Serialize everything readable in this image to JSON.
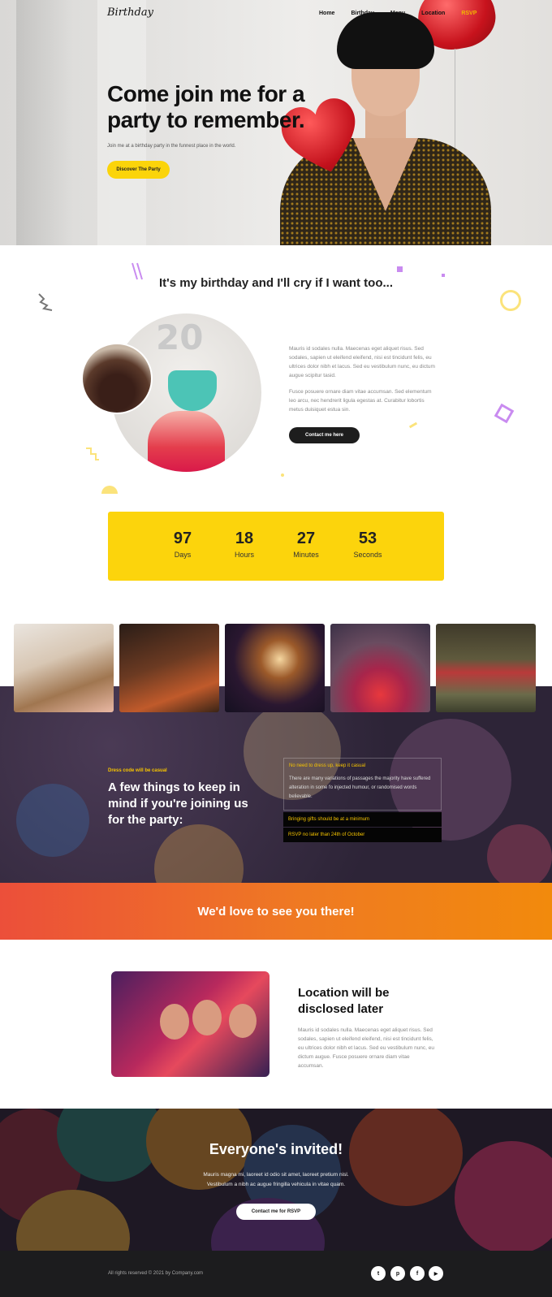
{
  "header": {
    "logo": "Birthday",
    "nav": [
      "Home",
      "Birthday",
      "Menu",
      "Location",
      "RSVP"
    ]
  },
  "hero": {
    "title": "Come join me for a party to remember.",
    "subtitle": "Join me at a birthday party in the funnest place in the world.",
    "cta": "Discover The Party"
  },
  "intro": {
    "title": "It's my birthday and I'll cry if I want too...",
    "balloon_text": "20",
    "p1": "Mauris id sodales nulla. Maecenas eget aliquet risus. Sed sodales, sapien ut eleifend eleifend, nisi est tincidunt felis, eu ultrices dolor nibh et lacus. Sed eu vestibulum nunc, eu dictum augue scipitur tasid.",
    "p2": "Fusce posuere ornare diam vitae accumsan. Sed elementum leo arcu, nec hendrerit ligula egestas at. Curabitur lobortis metus duisiquet estua sin.",
    "cta": "Contact me here"
  },
  "countdown": [
    {
      "value": "97",
      "label": "Days"
    },
    {
      "value": "18",
      "label": "Hours"
    },
    {
      "value": "27",
      "label": "Minutes"
    },
    {
      "value": "53",
      "label": "Seconds"
    }
  ],
  "things": {
    "eyebrow": "Dress code will be casual",
    "title": "A few things to keep in mind if you're joining us for the party:",
    "open_title": "No need to dress up, keep it casual",
    "open_body": "There are many variations of passages the majority have suffered alteration in some fo injected humour, or randomised words believable.",
    "item2": "Bringing gifts should be at a minimum",
    "item3": "RSVP no later than 24th of October"
  },
  "banner": {
    "title": "We'd love to see you there!"
  },
  "location": {
    "title": "Location will be disclosed later",
    "body": "Mauris id sodales nulla. Maecenas eget aliquet risus. Sed sodales, sapien ut eleifend eleifend, nisi est tincidunt felis, eu ultrices dolor nibh et lacus. Sed eu vestibulum nunc, eu dictum augue. Fusce posuere ornare diam vitae accumsan."
  },
  "invited": {
    "title": "Everyone's invited!",
    "body": "Mauris magna mi, laoreet id odio sit amet, laoreet pretium nisl. Vestibulum a nibh ac augue fringilla vehicula in vitae quam.",
    "cta": "Contact me for RSVP"
  },
  "footer": {
    "copyright": "All rights reserved © 2021 by Company.com",
    "social": [
      {
        "icon": "twitter-icon",
        "glyph": "t"
      },
      {
        "icon": "pinterest-icon",
        "glyph": "p"
      },
      {
        "icon": "facebook-icon",
        "glyph": "f"
      },
      {
        "icon": "youtube-icon",
        "glyph": "▶"
      }
    ]
  },
  "colors": {
    "accent_yellow": "#fcd40c",
    "banner_start": "#ec4f3a",
    "banner_end": "#f28a0c",
    "dark": "#1d1d1d"
  }
}
